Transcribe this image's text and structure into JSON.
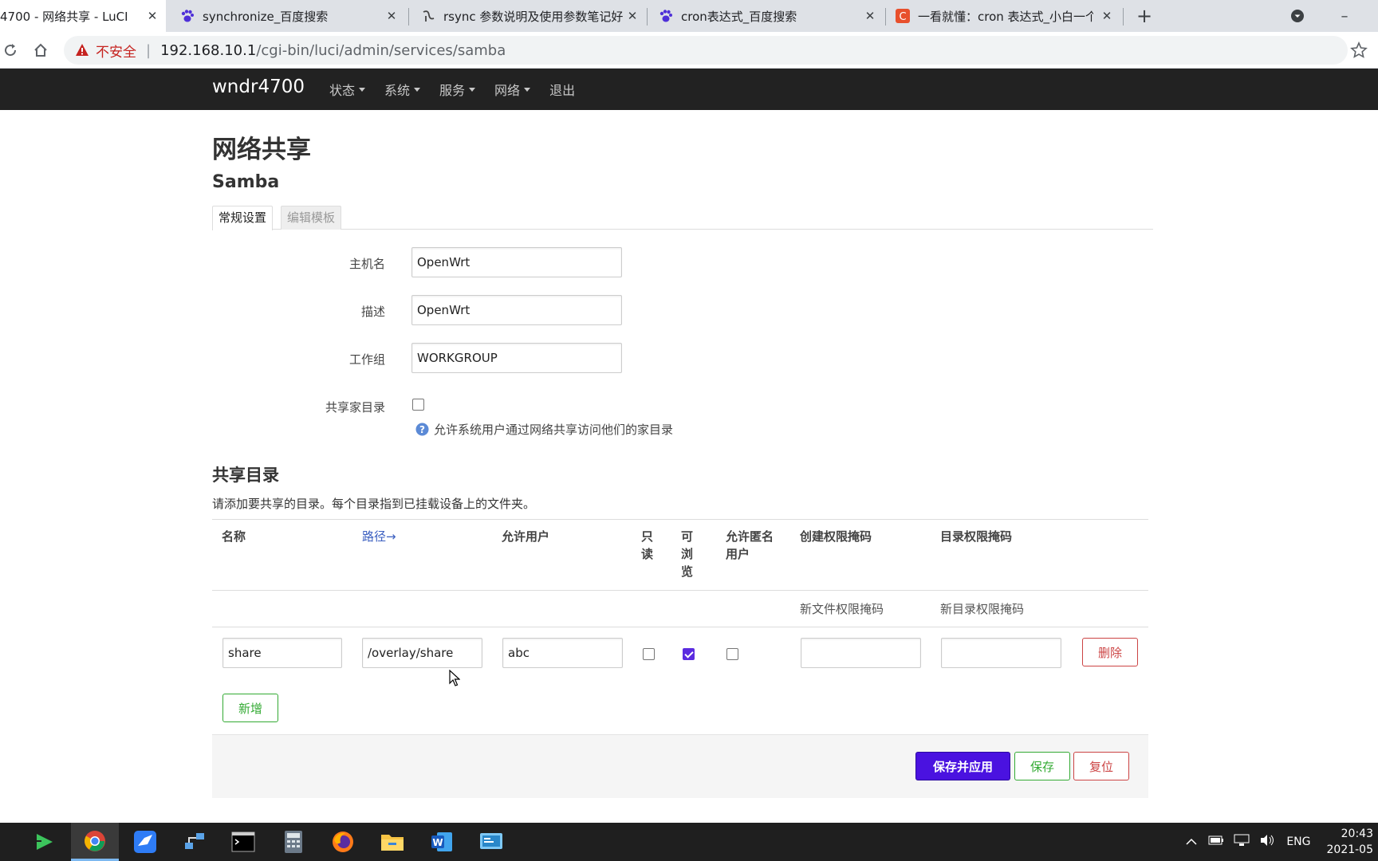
{
  "browser": {
    "tabs": [
      {
        "title": "4700 - 网络共享 - LuCI",
        "active": true
      },
      {
        "title": "synchronize_百度搜索",
        "active": false
      },
      {
        "title": "rsync 参数说明及使用参数笔记好",
        "active": false
      },
      {
        "title": "cron表达式_百度搜索",
        "active": false
      },
      {
        "title": "一看就懂：cron 表达式_小白一个",
        "active": false
      }
    ],
    "new_tab": "+",
    "insecure_label": "不安全",
    "url_host": "192.168.10.1",
    "url_path": "/cgi-bin/luci/admin/services/samba"
  },
  "navbar": {
    "brand": "wndr4700",
    "menu": [
      {
        "label": "状态",
        "dropdown": true
      },
      {
        "label": "系统",
        "dropdown": true
      },
      {
        "label": "服务",
        "dropdown": true
      },
      {
        "label": "网络",
        "dropdown": true
      },
      {
        "label": "退出",
        "dropdown": false
      }
    ]
  },
  "page": {
    "title": "网络共享",
    "section": "Samba",
    "tabs": [
      {
        "label": "常规设置",
        "active": true
      },
      {
        "label": "编辑模板",
        "active": false
      }
    ],
    "form": {
      "hostname": {
        "label": "主机名",
        "value": "OpenWrt"
      },
      "description": {
        "label": "描述",
        "value": "OpenWrt"
      },
      "workgroup": {
        "label": "工作组",
        "value": "WORKGROUP"
      },
      "homes": {
        "label": "共享家目录",
        "checked": false,
        "help": "允许系统用户通过网络共享访问他们的家目录"
      }
    },
    "shares": {
      "title": "共享目录",
      "description": "请添加要共享的目录。每个目录指到已挂载设备上的文件夹。",
      "columns": {
        "name": "名称",
        "path": "路径→",
        "users": "允许用户",
        "readonly_1": "只",
        "readonly_2": "读",
        "browseable_1": "可",
        "browseable_2": "浏",
        "browseable_3": "览",
        "guest_1": "允许匿名",
        "guest_2": "用户",
        "create_mask": "创建权限掩码",
        "dir_mask": "目录权限掩码"
      },
      "subheaders": {
        "create_mask": "新文件权限掩码",
        "dir_mask": "新目录权限掩码"
      },
      "rows": [
        {
          "name": "share",
          "path": "/overlay/share",
          "users": "abc",
          "read_only": false,
          "browseable": true,
          "guest_ok": false,
          "create_mask": "",
          "dir_mask": "",
          "delete_label": "删除"
        }
      ],
      "add_label": "新增"
    },
    "actions": {
      "save_apply": "保存并应用",
      "save": "保存",
      "reset": "复位"
    }
  },
  "taskbar": {
    "apps": [
      "media-player",
      "chrome",
      "feishu",
      "network-tool",
      "terminal",
      "calculator",
      "firefox",
      "file-explorer",
      "word",
      "remote-desktop"
    ],
    "tray": {
      "lang": "ENG",
      "time": "20:43",
      "date": "2021-05"
    }
  },
  "colors": {
    "primary": "#4a12e0",
    "danger": "#cc4444",
    "success": "#33aa33",
    "navbar": "#222222"
  }
}
